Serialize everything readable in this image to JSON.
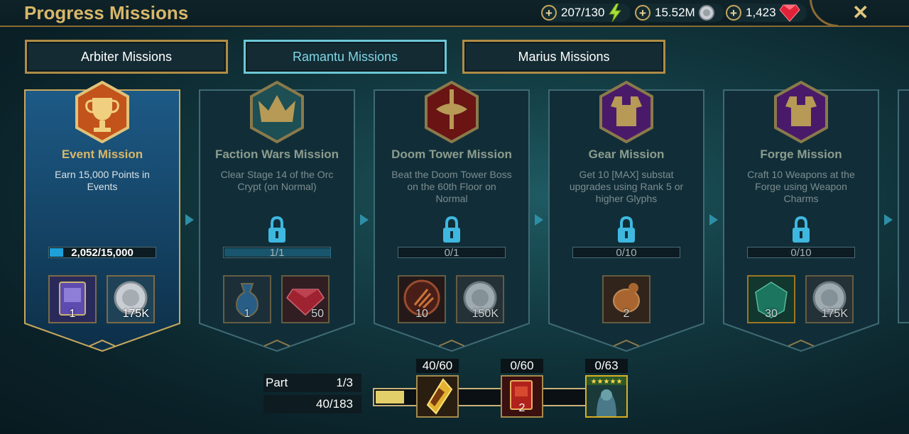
{
  "header": {
    "title": "Progress Missions",
    "energy": "207/130",
    "silver": "15.52M",
    "gems": "1,423",
    "close": "✕"
  },
  "tabs": [
    {
      "label": "Arbiter Missions",
      "active": false
    },
    {
      "label": "Ramantu Missions",
      "active": true
    },
    {
      "label": "Marius Missions",
      "active": false
    }
  ],
  "cards": [
    {
      "title": "Event Mission",
      "desc": "Earn 15,000 Points in Events",
      "progress": "2,052/15,000",
      "fill": 0.137,
      "locked": false,
      "rewards": [
        {
          "icon": "tome-icon",
          "qty": "1"
        },
        {
          "icon": "silver-coin-icon",
          "qty": "175K"
        }
      ]
    },
    {
      "title": "Faction Wars Mission",
      "desc": "Clear Stage 14 of the Orc Crypt (on Normal)",
      "progress": "1/1",
      "fill": 1.0,
      "locked": true,
      "rewards": [
        {
          "icon": "potion-icon",
          "qty": "1"
        },
        {
          "icon": "gem-icon",
          "qty": "50"
        }
      ]
    },
    {
      "title": "Doom Tower Mission",
      "desc": "Beat the Doom Tower Boss on the 60th Floor on Normal",
      "progress": "0/1",
      "fill": 0,
      "locked": true,
      "rewards": [
        {
          "icon": "doom-key-icon",
          "qty": "10"
        },
        {
          "icon": "silver-coin-icon",
          "qty": "150K"
        }
      ]
    },
    {
      "title": "Gear Mission",
      "desc": "Get 10 [MAX] substat upgrades using Rank 5 or higher Glyphs",
      "progress": "0/10",
      "fill": 0,
      "locked": true,
      "rewards": [
        {
          "icon": "chicken-icon",
          "qty": "2"
        }
      ]
    },
    {
      "title": "Forge Mission",
      "desc": "Craft 10 Weapons at the Forge using Weapon Charms",
      "progress": "0/10",
      "fill": 0,
      "locked": true,
      "rewards": [
        {
          "icon": "green-gem-icon",
          "qty": "30"
        },
        {
          "icon": "silver-coin-icon",
          "qty": "175K"
        }
      ]
    }
  ],
  "bottom": {
    "part_label": "Part",
    "part_value": "1/3",
    "points": "40/183",
    "fill": 0.131,
    "milestones": [
      {
        "label": "40/60",
        "icon": "shard-icon",
        "qty": ""
      },
      {
        "label": "0/60",
        "icon": "book-icon",
        "qty": "2"
      },
      {
        "label": "0/63",
        "icon": "champion-icon",
        "qty": ""
      }
    ]
  },
  "colors": {
    "gold": "#d8b76a",
    "accent": "#6cc7d6",
    "fill": "#1da0d8"
  }
}
